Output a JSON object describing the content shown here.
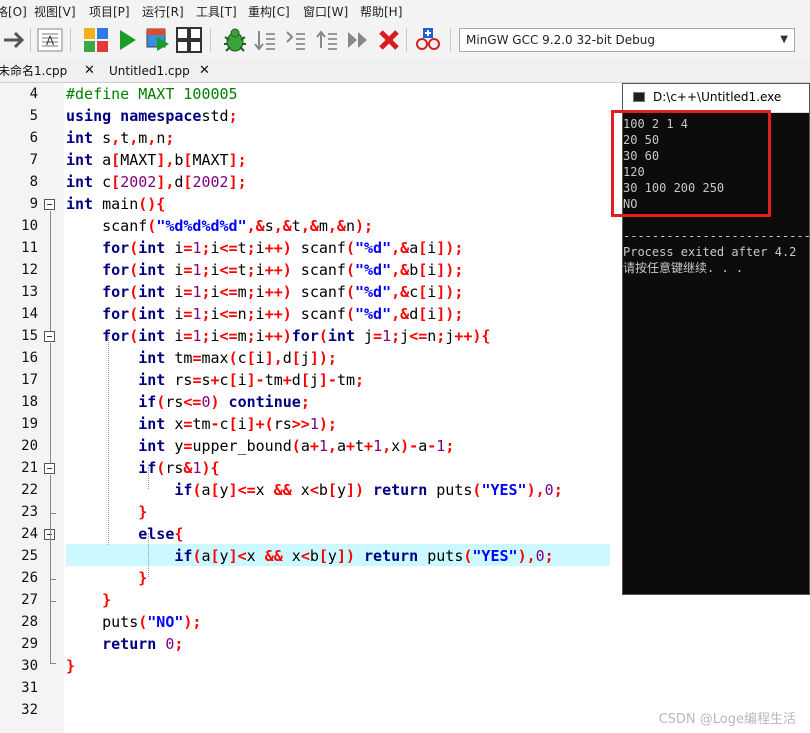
{
  "menu": {
    "items": [
      "格[O]",
      "视图[V]",
      "项目[P]",
      "运行[R]",
      "工具[T]",
      "重构[C]",
      "窗口[W]",
      "帮助[H]"
    ]
  },
  "toolbar": {
    "compiler": "MinGW GCC 9.2.0 32-bit Debug"
  },
  "tabs": [
    {
      "label": "未命名1.cpp"
    },
    {
      "label": "Untitled1.cpp"
    }
  ],
  "editor": {
    "line_numbers": [
      "4",
      "5",
      "6",
      "7",
      "8",
      "9",
      "10",
      "11",
      "12",
      "13",
      "14",
      "15",
      "16",
      "17",
      "18",
      "19",
      "20",
      "21",
      "22",
      "23",
      "24",
      "25",
      "26",
      "27",
      "28",
      "29",
      "30",
      "31",
      "32"
    ],
    "highlighted_line": "25"
  },
  "console": {
    "title": "D:\\c++\\Untitled1.exe",
    "output": [
      "100 2 1 4",
      "20 50",
      "30 60",
      "120",
      "30 100 200 250",
      "NO"
    ],
    "separator": "--------------------------------",
    "exit_msg": "Process exited after 4.2",
    "press_key": "请按任意键继续. . ."
  },
  "watermark": "CSDN @Loge编程生活",
  "colors": {
    "keyword": "#000080",
    "preprocessor": "#008000",
    "string": "#0000ff",
    "number": "#800080",
    "symbol": "#ff0000",
    "highlight": "#ccf8ff",
    "annotation_box": "#e32020"
  }
}
